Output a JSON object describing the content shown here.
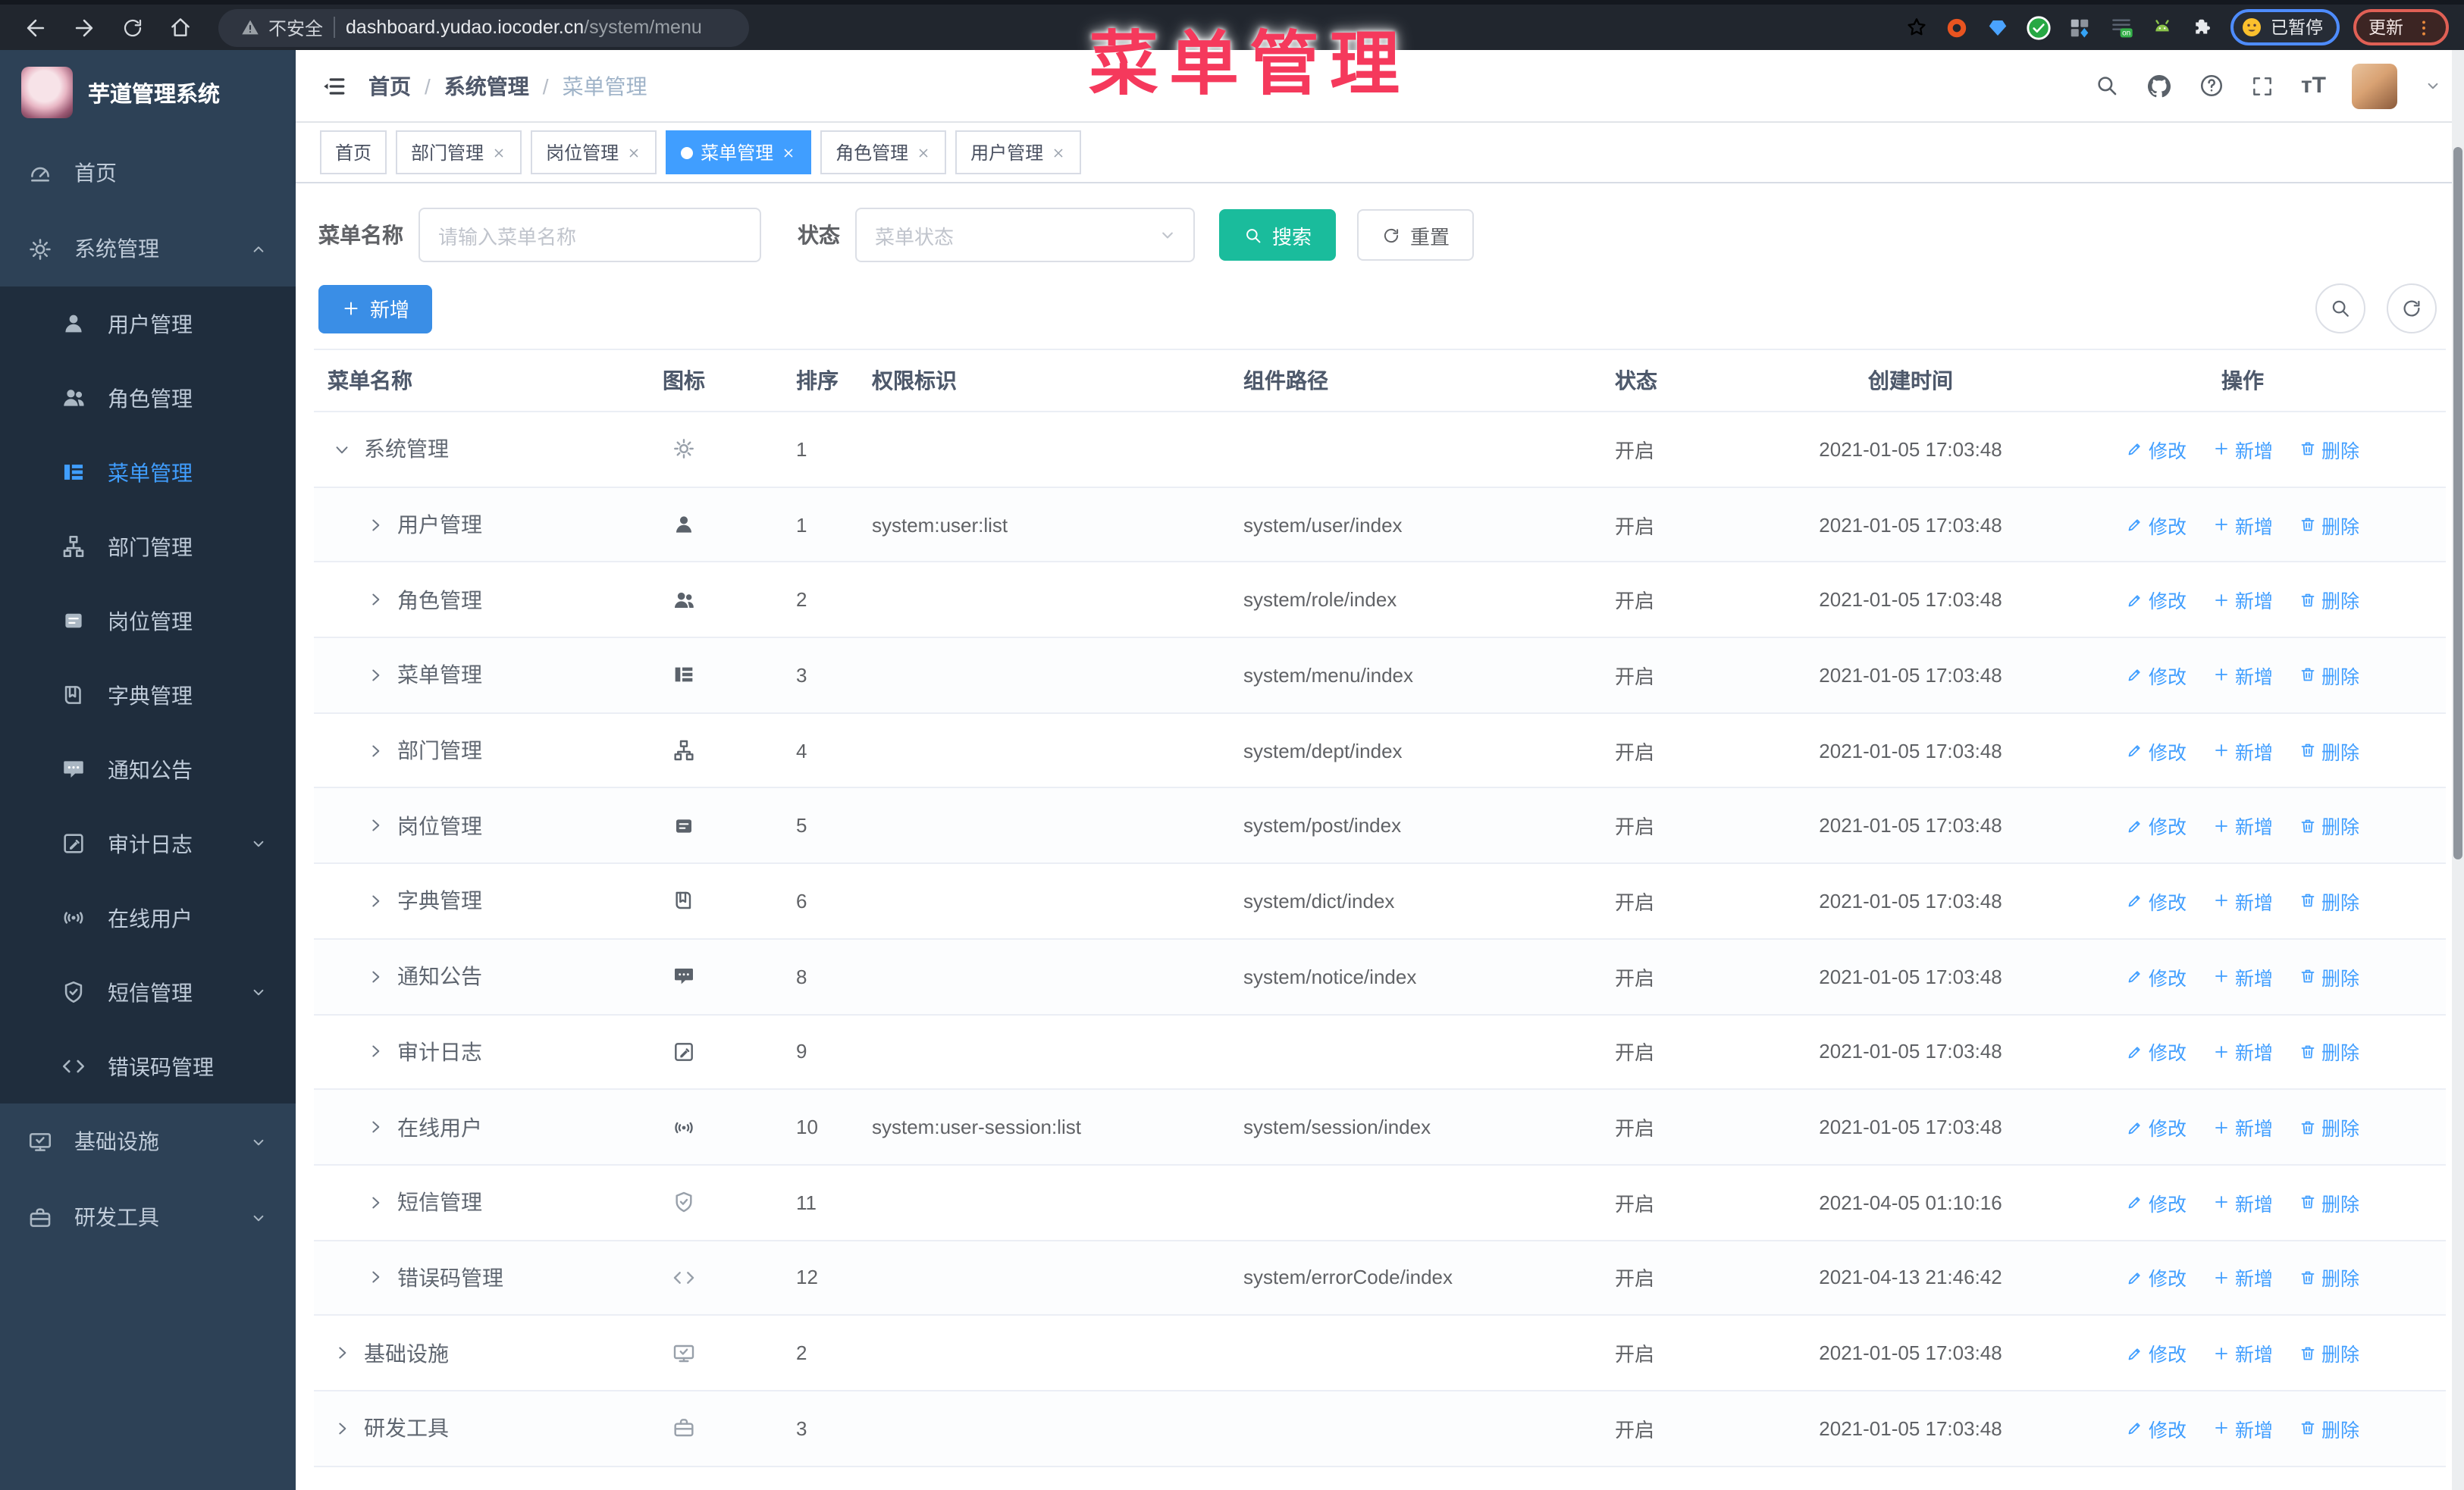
{
  "colors": {
    "accent": "#409EFF",
    "search_teal": "#1ABC9C",
    "annotation_pink": "#F5395C",
    "sidebar_bg": "#2D4156",
    "submenu_bg": "#1F2D3D",
    "active_tab_bg": "#409EFF"
  },
  "overlay_title": "菜单管理",
  "browser": {
    "security_label": "不安全",
    "url_host": "dashboard.yudao.iocoder.cn",
    "url_path": "/system/menu",
    "paused_label": "已暂停",
    "update_label": "更新",
    "nav_icons": [
      "back",
      "forward",
      "reload",
      "home"
    ],
    "extension_icons": [
      "bookmark-star",
      "orange-ring",
      "blue-gem",
      "green-check-circle",
      "grid-squares",
      "adblock-on",
      "android",
      "puzzle"
    ]
  },
  "sidebar": {
    "logo_title": "芋道管理系统",
    "items": [
      {
        "id": "home",
        "label": "首页",
        "icon": "dashboard",
        "level": 0
      },
      {
        "id": "system",
        "label": "系统管理",
        "icon": "gear",
        "level": 0,
        "arrow": "up",
        "expanded": true
      },
      {
        "id": "user",
        "label": "用户管理",
        "icon": "user",
        "level": 1
      },
      {
        "id": "role",
        "label": "角色管理",
        "icon": "peoples",
        "level": 1
      },
      {
        "id": "menu",
        "label": "菜单管理",
        "icon": "tree-table",
        "level": 1,
        "active": true
      },
      {
        "id": "dept",
        "label": "部门管理",
        "icon": "tree",
        "level": 1
      },
      {
        "id": "post",
        "label": "岗位管理",
        "icon": "post",
        "level": 1
      },
      {
        "id": "dict",
        "label": "字典管理",
        "icon": "dict",
        "level": 1
      },
      {
        "id": "notice",
        "label": "通知公告",
        "icon": "message",
        "level": 1
      },
      {
        "id": "audit-log",
        "label": "审计日志",
        "icon": "log",
        "level": 1,
        "arrow": "down"
      },
      {
        "id": "online-user",
        "label": "在线用户",
        "icon": "online",
        "level": 1
      },
      {
        "id": "sms",
        "label": "短信管理",
        "icon": "validCode",
        "level": 1,
        "arrow": "down"
      },
      {
        "id": "error-code",
        "label": "错误码管理",
        "icon": "code",
        "level": 1
      },
      {
        "id": "infra",
        "label": "基础设施",
        "icon": "monitor",
        "level": 0,
        "arrow": "down"
      },
      {
        "id": "dev-tools",
        "label": "研发工具",
        "icon": "tool",
        "level": 0,
        "arrow": "down"
      }
    ]
  },
  "header": {
    "breadcrumb": [
      "首页",
      "系统管理",
      "菜单管理"
    ],
    "right_icons": [
      "search",
      "github",
      "question",
      "fullscreen",
      "font-size",
      "avatar",
      "caret-down"
    ]
  },
  "tabs": [
    {
      "id": "home",
      "label": "首页",
      "closable": false,
      "active": false
    },
    {
      "id": "dept",
      "label": "部门管理",
      "closable": true,
      "active": false
    },
    {
      "id": "post",
      "label": "岗位管理",
      "closable": true,
      "active": false
    },
    {
      "id": "menu",
      "label": "菜单管理",
      "closable": true,
      "active": true
    },
    {
      "id": "role",
      "label": "角色管理",
      "closable": true,
      "active": false
    },
    {
      "id": "user",
      "label": "用户管理",
      "closable": true,
      "active": false
    }
  ],
  "filters": {
    "name_label": "菜单名称",
    "name_placeholder": "请输入菜单名称",
    "status_label": "状态",
    "status_placeholder": "菜单状态",
    "search_label": "搜索",
    "reset_label": "重置"
  },
  "toolbar": {
    "add_label": "新增"
  },
  "table": {
    "columns": [
      "菜单名称",
      "图标",
      "排序",
      "权限标识",
      "组件路径",
      "状态",
      "创建时间",
      "操作"
    ],
    "actions": [
      "修改",
      "新增",
      "删除"
    ],
    "status_open": "开启",
    "rows": [
      {
        "name": "系统管理",
        "icon": "gear",
        "icon_lite": true,
        "level": 0,
        "expanded": true,
        "sort": "1",
        "perm": "",
        "comp": "",
        "status": "开启",
        "time": "2021-01-05 17:03:48"
      },
      {
        "name": "用户管理",
        "icon": "user",
        "level": 1,
        "sort": "1",
        "perm": "system:user:list",
        "comp": "system/user/index",
        "status": "开启",
        "time": "2021-01-05 17:03:48"
      },
      {
        "name": "角色管理",
        "icon": "peoples",
        "level": 1,
        "sort": "2",
        "perm": "",
        "comp": "system/role/index",
        "status": "开启",
        "time": "2021-01-05 17:03:48"
      },
      {
        "name": "菜单管理",
        "icon": "tree-table",
        "level": 1,
        "sort": "3",
        "perm": "",
        "comp": "system/menu/index",
        "status": "开启",
        "time": "2021-01-05 17:03:48"
      },
      {
        "name": "部门管理",
        "icon": "tree",
        "level": 1,
        "sort": "4",
        "perm": "",
        "comp": "system/dept/index",
        "status": "开启",
        "time": "2021-01-05 17:03:48"
      },
      {
        "name": "岗位管理",
        "icon": "post",
        "level": 1,
        "sort": "5",
        "perm": "",
        "comp": "system/post/index",
        "status": "开启",
        "time": "2021-01-05 17:03:48"
      },
      {
        "name": "字典管理",
        "icon": "dict",
        "level": 1,
        "sort": "6",
        "perm": "",
        "comp": "system/dict/index",
        "status": "开启",
        "time": "2021-01-05 17:03:48"
      },
      {
        "name": "通知公告",
        "icon": "message",
        "level": 1,
        "sort": "8",
        "perm": "",
        "comp": "system/notice/index",
        "status": "开启",
        "time": "2021-01-05 17:03:48"
      },
      {
        "name": "审计日志",
        "icon": "log",
        "level": 1,
        "sort": "9",
        "perm": "",
        "comp": "",
        "status": "开启",
        "time": "2021-01-05 17:03:48"
      },
      {
        "name": "在线用户",
        "icon": "online",
        "level": 1,
        "sort": "10",
        "perm": "system:user-session:list",
        "comp": "system/session/index",
        "status": "开启",
        "time": "2021-01-05 17:03:48"
      },
      {
        "name": "短信管理",
        "icon": "validCode",
        "icon_lite": true,
        "level": 1,
        "sort": "11",
        "perm": "",
        "comp": "",
        "status": "开启",
        "time": "2021-04-05 01:10:16"
      },
      {
        "name": "错误码管理",
        "icon": "code",
        "icon_lite": true,
        "level": 1,
        "sort": "12",
        "perm": "",
        "comp": "system/errorCode/index",
        "status": "开启",
        "time": "2021-04-13 21:46:42"
      },
      {
        "name": "基础设施",
        "icon": "monitor",
        "icon_lite": true,
        "level": 0,
        "sort": "2",
        "perm": "",
        "comp": "",
        "status": "开启",
        "time": "2021-01-05 17:03:48"
      },
      {
        "name": "研发工具",
        "icon": "tool",
        "icon_lite": true,
        "level": 0,
        "sort": "3",
        "perm": "",
        "comp": "",
        "status": "开启",
        "time": "2021-01-05 17:03:48"
      }
    ]
  }
}
